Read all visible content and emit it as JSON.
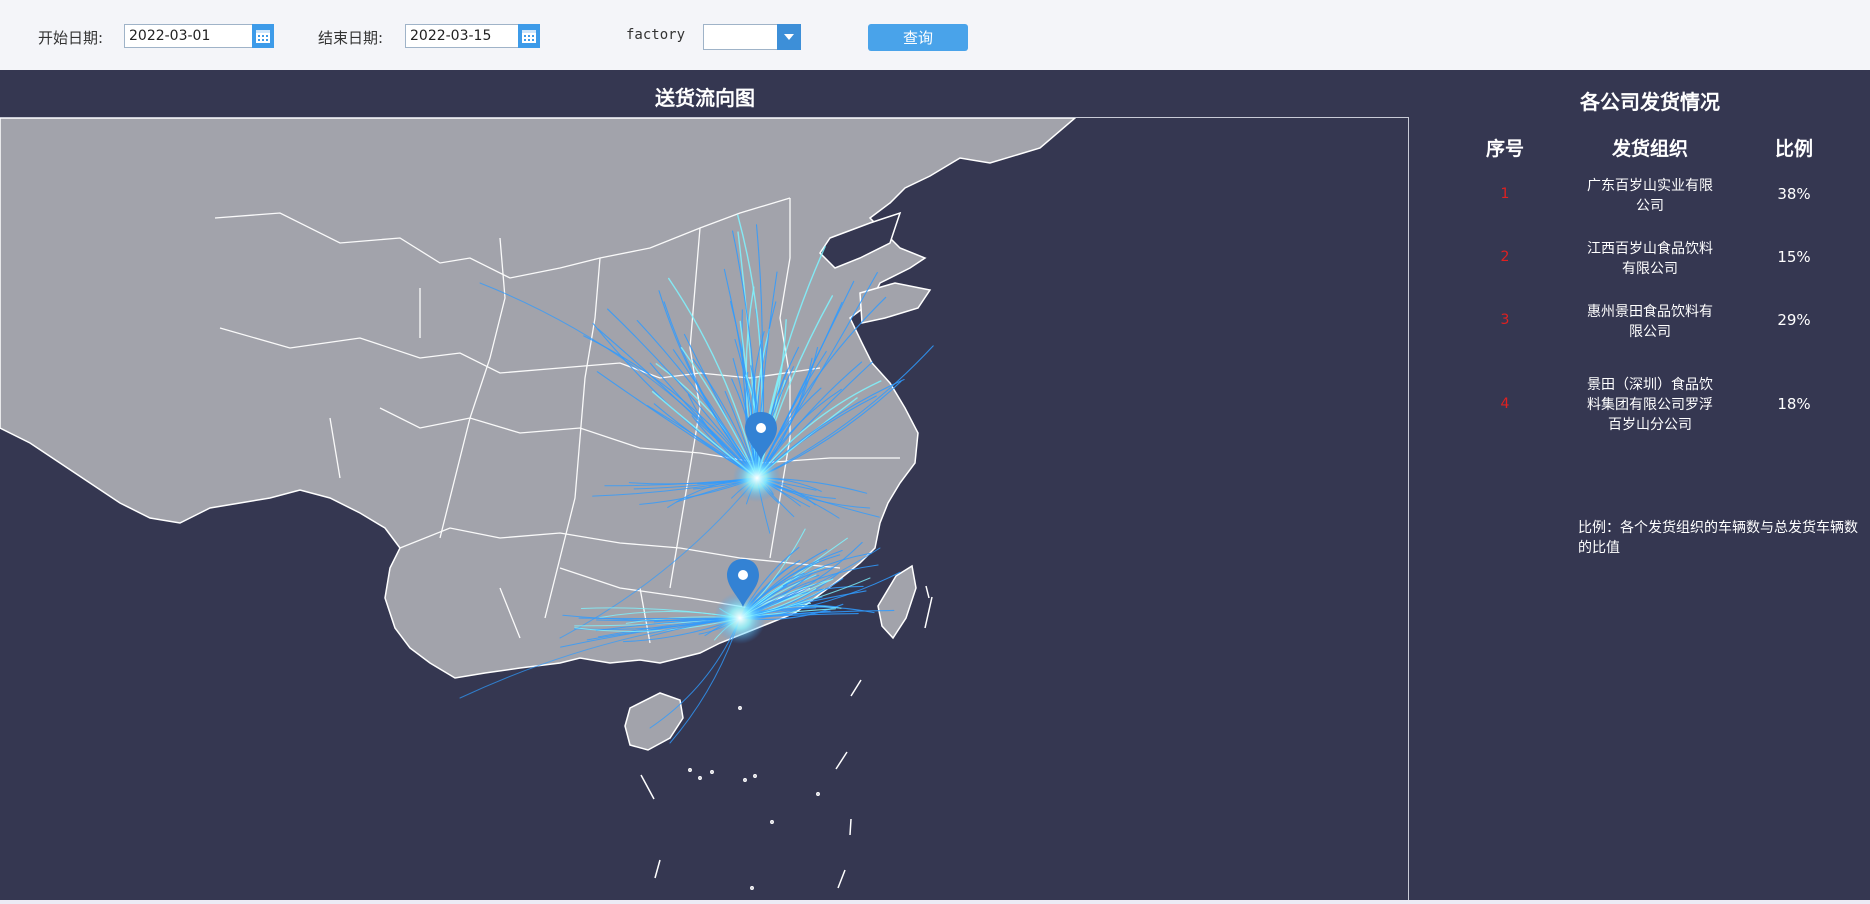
{
  "filters": {
    "start_label": "开始日期:",
    "start_value": "2022-03-01",
    "end_label": "结束日期:",
    "end_value": "2022-03-15",
    "factory_label": "factory",
    "factory_value": "",
    "query_label": "查询"
  },
  "map": {
    "title": "送货流向图"
  },
  "panel": {
    "title": "各公司发货情况",
    "headers": {
      "index": "序号",
      "org": "发货组织",
      "ratio": "比例"
    },
    "rows": [
      {
        "index": "1",
        "org_lines": [
          "广东百岁山实业有限",
          "公司"
        ],
        "ratio": "38%"
      },
      {
        "index": "2",
        "org_lines": [
          "江西百岁山食品饮料",
          "有限公司"
        ],
        "ratio": "15%"
      },
      {
        "index": "3",
        "org_lines": [
          "惠州景田食品饮料有",
          "限公司"
        ],
        "ratio": "29%"
      },
      {
        "index": "4",
        "org_lines": [
          "景田（深圳）食品饮",
          "料集团有限公司罗浮",
          "百岁山分公司"
        ],
        "ratio": "18%"
      }
    ],
    "note": "比例：各个发货组织的车辆数与总发货车辆数的比值"
  },
  "colors": {
    "dashboard_bg": "#353751",
    "land": "#a2a3ab",
    "flow": "#2f9bff",
    "flow_glow": "#7ff4ff",
    "index_red": "#e02020",
    "button_blue": "#49a3ea"
  }
}
